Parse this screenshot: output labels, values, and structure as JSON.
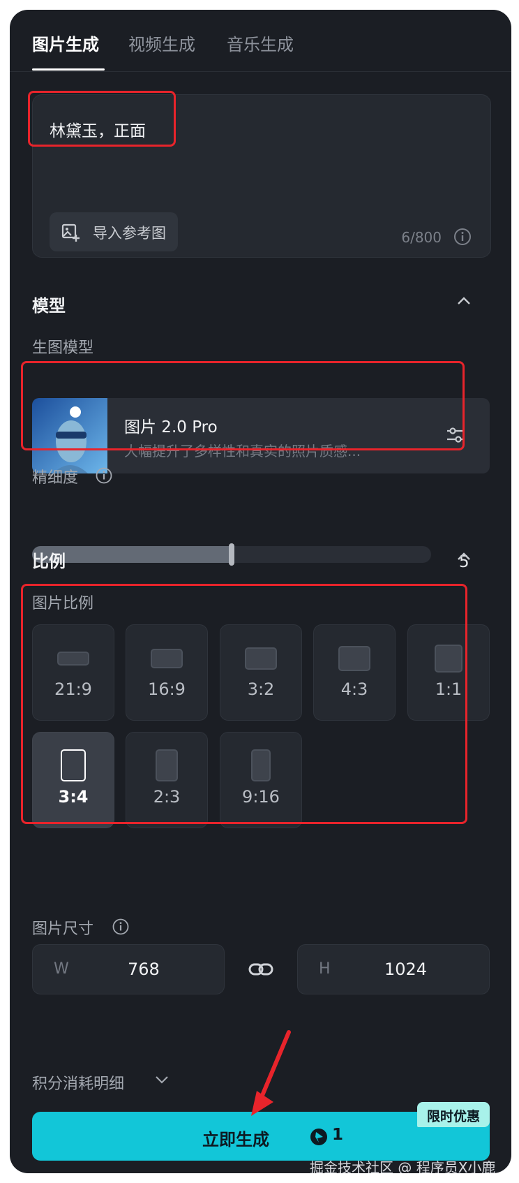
{
  "tabs": [
    {
      "label": "图片生成",
      "active": true
    },
    {
      "label": "视频生成",
      "active": false
    },
    {
      "label": "音乐生成",
      "active": false
    }
  ],
  "prompt": {
    "text": "林黛玉，正面",
    "import_label": "导入参考图",
    "char_count": "6/800"
  },
  "model_section": {
    "title": "模型",
    "sub_label": "生图模型",
    "model_name": "图片 2.0 Pro",
    "model_desc": "大幅提升了多样性和真实的照片质感...",
    "detail_label": "精细度",
    "detail_value": "5",
    "detail_fraction": 0.5
  },
  "ratio_section": {
    "title": "比例",
    "sub_label": "图片比例",
    "ratios": [
      {
        "label": "21:9",
        "selected": false
      },
      {
        "label": "16:9",
        "selected": false
      },
      {
        "label": "3:2",
        "selected": false
      },
      {
        "label": "4:3",
        "selected": false
      },
      {
        "label": "1:1",
        "selected": false
      },
      {
        "label": "3:4",
        "selected": true
      },
      {
        "label": "2:3",
        "selected": false
      },
      {
        "label": "9:16",
        "selected": false
      }
    ],
    "size_label": "图片尺寸",
    "width_prefix": "W",
    "width_value": "768",
    "height_prefix": "H",
    "height_value": "1024"
  },
  "credits_label": "积分消耗明细",
  "generate": {
    "label": "立即生成",
    "cost": "1",
    "promo": "限时优惠"
  },
  "watermark": "掘金技术社区 @ 程序员X小鹿",
  "colors": {
    "accent": "#12c6d8",
    "highlight": "#e8242b",
    "panel_bg": "#1b1e24"
  }
}
